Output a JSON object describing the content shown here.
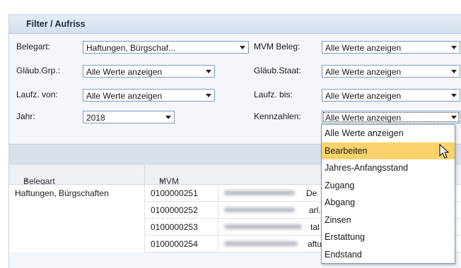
{
  "panel": {
    "title": "Filter / Aufriss"
  },
  "filters": {
    "belegart": {
      "label": "Belegart:",
      "value": "Haftungen, Bürgschaf..."
    },
    "mvm_beleg": {
      "label": "MVM Beleg:",
      "value": "Alle Werte anzeigen"
    },
    "glaeub_grp": {
      "label": "Gläub.Grp.:",
      "value": "Alle Werte anzeigen"
    },
    "glaeub_staat": {
      "label": "Gläub.Staat:",
      "value": "Alle Werte anzeigen"
    },
    "laufz_von": {
      "label": "Laufz. von:",
      "value": "Alle Werte anzeigen"
    },
    "laufz_bis": {
      "label": "Laufz. bis:",
      "value": "Alle Werte anzeigen"
    },
    "jahr": {
      "label": "Jahr:",
      "value": "2018"
    },
    "kennzahlen": {
      "label": "Kennzahlen:",
      "value": "Alle Werte anzeigen"
    }
  },
  "dropdown": {
    "options": [
      "Alle Werte anzeigen",
      "Bearbeiten",
      "Jahres-Anfangsstand",
      "Zugang",
      "Abgang",
      "Zinsen",
      "Erstattung",
      "Endstand"
    ],
    "highlighted": "Bearbeiten"
  },
  "table": {
    "columns": [
      "Belegart",
      "MVM Beleg"
    ],
    "sort_icon": "sort-asc-icon",
    "group_label": "Haftungen, Bürgschaften",
    "rows": [
      {
        "mvm_beleg": "0100000251",
        "partial": "De"
      },
      {
        "mvm_beleg": "0100000252",
        "partial": "arl."
      },
      {
        "mvm_beleg": "0100000253",
        "partial": "tal"
      },
      {
        "mvm_beleg": "0100000254",
        "partial": "aftu"
      }
    ]
  },
  "colors": {
    "highlight": "#fad26b",
    "header": "#d3e0ef",
    "border": "#7f9db9"
  }
}
